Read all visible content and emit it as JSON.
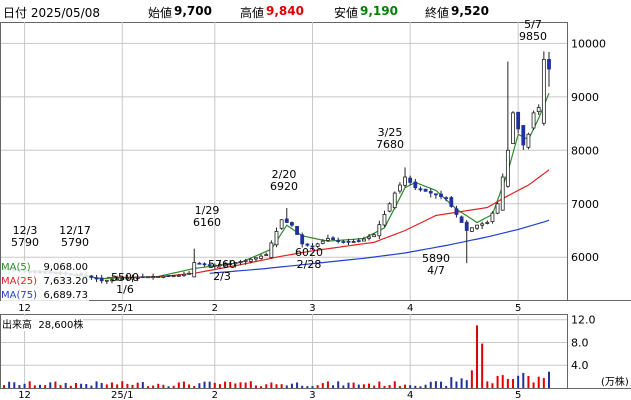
{
  "header": {
    "date": "日付 2025/05/08",
    "open_label": "始値",
    "open_value": "9,700",
    "high_label": "高値",
    "high_value": "9,840",
    "low_label": "安値",
    "low_value": "9,190",
    "close_label": "終値",
    "close_value": "9,520",
    "colors": {
      "high": "#e00000",
      "low": "#008000",
      "label": "#000000"
    }
  },
  "legend": [
    {
      "name": "MA(5)",
      "value": "9,068.00",
      "color": "#2e8b2e"
    },
    {
      "name": "MA(25)",
      "value": "7,633.20",
      "color": "#e02020"
    },
    {
      "name": "MA(75)",
      "value": "6,689.73",
      "color": "#2040d0"
    }
  ],
  "volume_label": {
    "name": "出来高",
    "value": "28,600株"
  },
  "price_axis": {
    "ticks": [
      "10000",
      "9000",
      "8000",
      "7000",
      "6000"
    ]
  },
  "volume_axis": {
    "ticks": [
      "12.0",
      "8.0",
      "4.0"
    ],
    "unit": "(万株)"
  },
  "x_axis": {
    "ticks": [
      "12",
      "25/1",
      "2",
      "3",
      "4",
      "5"
    ]
  },
  "annotations": [
    {
      "date": "12/3",
      "price": "5790"
    },
    {
      "date": "12/17",
      "price": "5790"
    },
    {
      "date": "1/6",
      "price": "5500"
    },
    {
      "date": "1/29",
      "price": "6160"
    },
    {
      "date": "2/3",
      "price": "5760"
    },
    {
      "date": "2/20",
      "price": "6920"
    },
    {
      "date": "2/28",
      "price": "6020"
    },
    {
      "date": "3/25",
      "price": "7680"
    },
    {
      "date": "4/7",
      "price": "5890"
    },
    {
      "date": "5/7",
      "price": "9850"
    }
  ],
  "chart_data": {
    "type": "candlestick",
    "title": "",
    "x_axis_ticks": [
      "12",
      "25/1",
      "2",
      "3",
      "4",
      "5"
    ],
    "y_axis_ticks": [
      6000,
      7000,
      8000,
      9000,
      10000
    ],
    "ylim": [
      5200,
      10400
    ],
    "volume_ylim": [
      0,
      13
    ],
    "volume_unit": "万株",
    "grid": true,
    "up_color": "#e00000",
    "down_color": "#2030a0",
    "session_index_start": 0,
    "month_starts": {
      "12": 0,
      "25/1": 19,
      "2": 37,
      "3": 56,
      "4": 75,
      "5": 96
    },
    "sessions": 102,
    "ohlc_key_points": [
      {
        "date": "12/3",
        "close": 5790
      },
      {
        "date": "12/17",
        "close": 5790
      },
      {
        "date": "1/6",
        "low": 5500
      },
      {
        "date": "1/29",
        "high": 6160
      },
      {
        "date": "2/3",
        "low": 5760
      },
      {
        "date": "2/20",
        "high": 6920
      },
      {
        "date": "2/28",
        "low": 6020
      },
      {
        "date": "3/25",
        "high": 7680
      },
      {
        "date": "4/7",
        "low": 5890
      },
      {
        "date": "5/7",
        "high": 9850
      },
      {
        "date": "5/8",
        "open": 9700,
        "high": 9840,
        "low": 9190,
        "close": 9520
      }
    ],
    "close_path": [
      [
        0,
        5780
      ],
      [
        4,
        5740
      ],
      [
        8,
        5720
      ],
      [
        12,
        5700
      ],
      [
        16,
        5660
      ],
      [
        19,
        5560
      ],
      [
        22,
        5590
      ],
      [
        26,
        5630
      ],
      [
        30,
        5640
      ],
      [
        34,
        5660
      ],
      [
        36,
        5700
      ],
      [
        37,
        5900
      ],
      [
        40,
        5840
      ],
      [
        44,
        5880
      ],
      [
        48,
        5960
      ],
      [
        51,
        6050
      ],
      [
        54,
        6700
      ],
      [
        56,
        6600
      ],
      [
        58,
        6250
      ],
      [
        60,
        6200
      ],
      [
        63,
        6350
      ],
      [
        66,
        6280
      ],
      [
        69,
        6300
      ],
      [
        72,
        6420
      ],
      [
        74,
        6800
      ],
      [
        76,
        7200
      ],
      [
        78,
        7500
      ],
      [
        80,
        7300
      ],
      [
        83,
        7200
      ],
      [
        86,
        7100
      ],
      [
        88,
        6800
      ],
      [
        90,
        6500
      ],
      [
        92,
        6600
      ],
      [
        94,
        6650
      ],
      [
        96,
        7000
      ],
      [
        98,
        8000
      ],
      [
        99,
        8700
      ],
      [
        100,
        8400
      ],
      [
        101,
        8100
      ],
      [
        102,
        8300
      ],
      [
        103,
        8700
      ],
      [
        104,
        8800
      ],
      [
        105,
        9700
      ],
      [
        106,
        9520
      ]
    ],
    "ma_series": [
      {
        "name": "MA(5)",
        "color": "#2e8b2e",
        "points": [
          [
            0,
            5780
          ],
          [
            10,
            5720
          ],
          [
            19,
            5600
          ],
          [
            30,
            5640
          ],
          [
            37,
            5790
          ],
          [
            46,
            5900
          ],
          [
            52,
            6150
          ],
          [
            55,
            6600
          ],
          [
            58,
            6400
          ],
          [
            63,
            6300
          ],
          [
            70,
            6350
          ],
          [
            74,
            6550
          ],
          [
            78,
            7300
          ],
          [
            80,
            7400
          ],
          [
            84,
            7250
          ],
          [
            88,
            6900
          ],
          [
            92,
            6650
          ],
          [
            95,
            6800
          ],
          [
            98,
            7600
          ],
          [
            100,
            8300
          ],
          [
            102,
            8200
          ],
          [
            104,
            8600
          ],
          [
            106,
            9068
          ]
        ]
      },
      {
        "name": "MA(25)",
        "color": "#e02020",
        "points": [
          [
            20,
            5620
          ],
          [
            30,
            5630
          ],
          [
            37,
            5700
          ],
          [
            46,
            5860
          ],
          [
            54,
            6020
          ],
          [
            60,
            6120
          ],
          [
            66,
            6200
          ],
          [
            72,
            6280
          ],
          [
            78,
            6500
          ],
          [
            84,
            6780
          ],
          [
            90,
            6870
          ],
          [
            94,
            6930
          ],
          [
            98,
            7150
          ],
          [
            102,
            7350
          ],
          [
            106,
            7633
          ]
        ]
      },
      {
        "name": "MA(75)",
        "color": "#2040d0",
        "points": [
          [
            40,
            5700
          ],
          [
            50,
            5780
          ],
          [
            60,
            5880
          ],
          [
            70,
            5980
          ],
          [
            78,
            6080
          ],
          [
            86,
            6220
          ],
          [
            94,
            6380
          ],
          [
            100,
            6520
          ],
          [
            106,
            6690
          ]
        ]
      }
    ],
    "volume_key_bars": [
      {
        "date": "4/9",
        "value": 11.0,
        "color": "#e00000"
      },
      {
        "date": "5/8",
        "value": 2.86,
        "color": "#2030a0"
      }
    ]
  }
}
